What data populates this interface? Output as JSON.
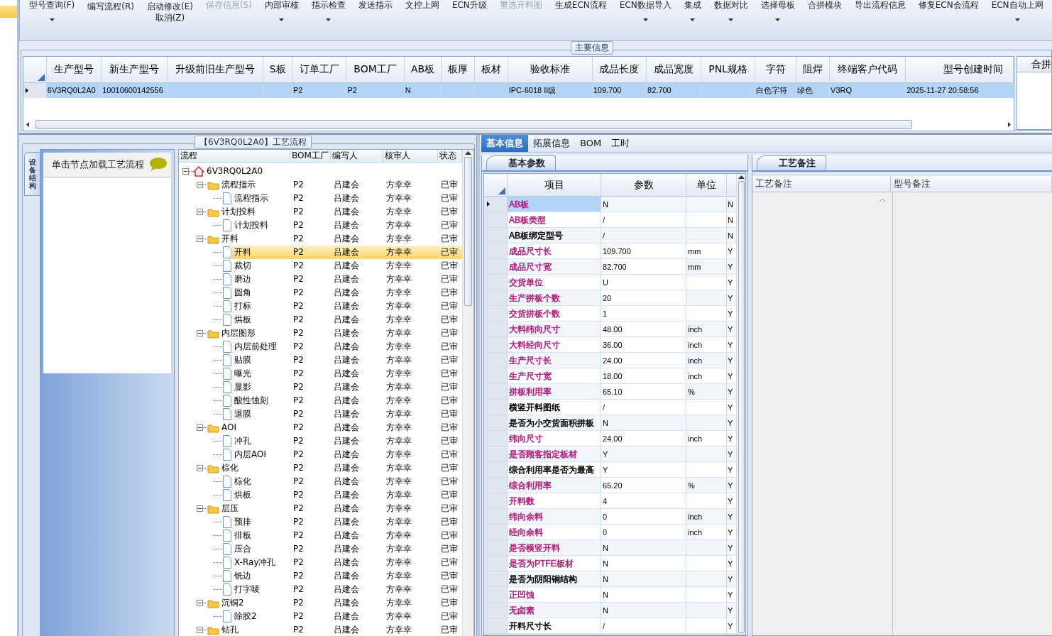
{
  "toolbar": {
    "columns": [
      {
        "buttons": [
          {
            "label": "型号查询(F)",
            "kind": "upper",
            "dropdown": true,
            "disabled": false
          }
        ]
      },
      {
        "buttons": [
          {
            "label": "编写流程(R)",
            "kind": "lower",
            "dropdown": false,
            "disabled": false
          }
        ]
      },
      {
        "buttons": [
          {
            "label": "启动修改(E)",
            "kind": "lower",
            "dropdown": false,
            "disabled": false
          },
          {
            "label": "取消(Z)",
            "kind": "lower",
            "dropdown": false,
            "disabled": false
          }
        ]
      },
      {
        "buttons": [
          {
            "label": "保存信息(S)",
            "kind": "upper",
            "dropdown": false,
            "disabled": true
          }
        ]
      },
      {
        "buttons": [
          {
            "label": "内部审核",
            "kind": "upper",
            "dropdown": true,
            "disabled": false
          }
        ]
      },
      {
        "buttons": [
          {
            "label": "指示检查",
            "kind": "upper",
            "dropdown": true,
            "disabled": false
          }
        ]
      },
      {
        "buttons": [
          {
            "label": "发送指示",
            "kind": "upper",
            "dropdown": false,
            "disabled": false
          }
        ]
      },
      {
        "buttons": [
          {
            "label": "文控上网",
            "kind": "upper",
            "dropdown": false,
            "disabled": false
          }
        ]
      },
      {
        "buttons": [
          {
            "label": "ECN升级",
            "kind": "upper",
            "dropdown": false,
            "disabled": false
          }
        ]
      },
      {
        "buttons": [
          {
            "label": "重选开料图",
            "kind": "upper",
            "dropdown": false,
            "disabled": true
          }
        ]
      },
      {
        "buttons": [
          {
            "label": "生成ECN流程",
            "kind": "upper",
            "dropdown": false,
            "disabled": false
          }
        ]
      },
      {
        "buttons": [
          {
            "label": "ECN数据导入",
            "kind": "upper",
            "dropdown": true,
            "disabled": false
          }
        ]
      },
      {
        "buttons": [
          {
            "label": "集成",
            "kind": "upper",
            "dropdown": true,
            "disabled": false
          }
        ]
      },
      {
        "buttons": [
          {
            "label": "数据对比",
            "kind": "upper",
            "dropdown": true,
            "disabled": false
          }
        ]
      },
      {
        "buttons": [
          {
            "label": "选择母板",
            "kind": "upper",
            "dropdown": true,
            "disabled": false
          }
        ]
      },
      {
        "buttons": [
          {
            "label": "合拼模块",
            "kind": "upper",
            "dropdown": false,
            "disabled": false
          }
        ]
      },
      {
        "buttons": [
          {
            "label": "导出流程信息",
            "kind": "upper",
            "dropdown": false,
            "disabled": false
          }
        ]
      },
      {
        "buttons": [
          {
            "label": "修复ECN会流程",
            "kind": "upper",
            "dropdown": false,
            "disabled": false
          }
        ]
      },
      {
        "buttons": [
          {
            "label": "ECN自动上网",
            "kind": "upper",
            "dropdown": true,
            "disabled": false
          }
        ]
      }
    ]
  },
  "main_info": {
    "title": "主要信息",
    "columns": [
      "生产型号",
      "新生产型号",
      "升级前旧生产型号",
      "S板",
      "订单工厂",
      "BOM工厂",
      "AB板",
      "板厚",
      "板材",
      "验收标准",
      "成品长度",
      "成品宽度",
      "PNL规格",
      "字符",
      "阻焊",
      "终端客户代码",
      "型号创建时间"
    ],
    "rows": [
      {
        "selected": true,
        "cells": [
          "6V3RQ0L2A0",
          "10010600142556",
          null,
          null,
          "P2",
          "P2",
          "N",
          null,
          null,
          "IPC-6018 II级",
          "109.700",
          "82.700",
          null,
          "白色字符",
          "绿色",
          "V3RQ",
          "2025-11-27 20:58:56"
        ]
      }
    ],
    "side_column": "合拼"
  },
  "flow": {
    "title": "【6V3RQ0L2A0】工艺流程",
    "side_tab": "设备结构",
    "hint": "单击节点加载工艺流程",
    "columns": [
      "流程",
      "BOM工厂",
      "编写人",
      "核审人",
      "状态"
    ],
    "tree": [
      {
        "label": "6V3RQ0L2A0",
        "kind": "root",
        "expanded": true,
        "selected": false,
        "children": [
          {
            "label": "流程指示",
            "kind": "folder",
            "expanded": true,
            "selected": false,
            "bom": "P2",
            "writer": "吕建会",
            "reviewer": "方幸幸",
            "status": "已审",
            "children": [
              {
                "label": "流程指示",
                "kind": "step",
                "selected": false,
                "bom": "P2",
                "writer": "吕建会",
                "reviewer": "方幸幸",
                "status": "已审"
              }
            ]
          },
          {
            "label": "计划投料",
            "kind": "folder",
            "expanded": true,
            "selected": false,
            "bom": "P2",
            "writer": "吕建会",
            "reviewer": "方幸幸",
            "status": "已审",
            "children": [
              {
                "label": "计划投料",
                "kind": "step",
                "selected": false,
                "bom": "P2",
                "writer": "吕建会",
                "reviewer": "方幸幸",
                "status": "已审"
              }
            ]
          },
          {
            "label": "开料",
            "kind": "folder",
            "expanded": true,
            "selected": false,
            "bom": "P2",
            "writer": "吕建会",
            "reviewer": "方幸幸",
            "status": "已审",
            "children": [
              {
                "label": "开料",
                "kind": "step",
                "selected": true,
                "bom": "P2",
                "writer": "吕建会",
                "reviewer": "方幸幸",
                "status": "已审"
              },
              {
                "label": "裁切",
                "kind": "step",
                "selected": false,
                "bom": "P2",
                "writer": "吕建会",
                "reviewer": "方幸幸",
                "status": "已审"
              },
              {
                "label": "磨边",
                "kind": "step",
                "selected": false,
                "bom": "P2",
                "writer": "吕建会",
                "reviewer": "方幸幸",
                "status": "已审"
              },
              {
                "label": "圆角",
                "kind": "step",
                "selected": false,
                "bom": "P2",
                "writer": "吕建会",
                "reviewer": "方幸幸",
                "status": "已审"
              },
              {
                "label": "打标",
                "kind": "step",
                "selected": false,
                "bom": "P2",
                "writer": "吕建会",
                "reviewer": "方幸幸",
                "status": "已审"
              },
              {
                "label": "烘板",
                "kind": "step",
                "selected": false,
                "bom": "P2",
                "writer": "吕建会",
                "reviewer": "方幸幸",
                "status": "已审"
              }
            ]
          },
          {
            "label": "内层图形",
            "kind": "folder",
            "expanded": true,
            "selected": false,
            "bom": "P2",
            "writer": "吕建会",
            "reviewer": "方幸幸",
            "status": "已审",
            "children": [
              {
                "label": "内层前处理",
                "kind": "step",
                "selected": false,
                "bom": "P2",
                "writer": "吕建会",
                "reviewer": "方幸幸",
                "status": "已审"
              },
              {
                "label": "贴膜",
                "kind": "step",
                "selected": false,
                "bom": "P2",
                "writer": "吕建会",
                "reviewer": "方幸幸",
                "status": "已审"
              },
              {
                "label": "曝光",
                "kind": "step",
                "selected": false,
                "bom": "P2",
                "writer": "吕建会",
                "reviewer": "方幸幸",
                "status": "已审"
              },
              {
                "label": "显影",
                "kind": "step",
                "selected": false,
                "bom": "P2",
                "writer": "吕建会",
                "reviewer": "方幸幸",
                "status": "已审"
              },
              {
                "label": "酸性蚀刻",
                "kind": "step",
                "selected": false,
                "bom": "P2",
                "writer": "吕建会",
                "reviewer": "方幸幸",
                "status": "已审"
              },
              {
                "label": "退膜",
                "kind": "step",
                "selected": false,
                "bom": "P2",
                "writer": "吕建会",
                "reviewer": "方幸幸",
                "status": "已审"
              }
            ]
          },
          {
            "label": "AOI",
            "kind": "folder",
            "expanded": true,
            "selected": false,
            "bom": "P2",
            "writer": "吕建会",
            "reviewer": "方幸幸",
            "status": "已审",
            "children": [
              {
                "label": "冲孔",
                "kind": "step",
                "selected": false,
                "bom": "P2",
                "writer": "吕建会",
                "reviewer": "方幸幸",
                "status": "已审"
              },
              {
                "label": "内层AOI",
                "kind": "step",
                "selected": false,
                "bom": "P2",
                "writer": "吕建会",
                "reviewer": "方幸幸",
                "status": "已审"
              }
            ]
          },
          {
            "label": "棕化",
            "kind": "folder",
            "expanded": true,
            "selected": false,
            "bom": "P2",
            "writer": "吕建会",
            "reviewer": "方幸幸",
            "status": "已审",
            "children": [
              {
                "label": "棕化",
                "kind": "step",
                "selected": false,
                "bom": "P2",
                "writer": "吕建会",
                "reviewer": "方幸幸",
                "status": "已审"
              },
              {
                "label": "烘板",
                "kind": "step",
                "selected": false,
                "bom": "P2",
                "writer": "吕建会",
                "reviewer": "方幸幸",
                "status": "已审"
              }
            ]
          },
          {
            "label": "层压",
            "kind": "folder",
            "expanded": true,
            "selected": false,
            "bom": "P2",
            "writer": "吕建会",
            "reviewer": "方幸幸",
            "status": "已审",
            "children": [
              {
                "label": "预排",
                "kind": "step",
                "selected": false,
                "bom": "P2",
                "writer": "吕建会",
                "reviewer": "方幸幸",
                "status": "已审"
              },
              {
                "label": "排板",
                "kind": "step",
                "selected": false,
                "bom": "P2",
                "writer": "吕建会",
                "reviewer": "方幸幸",
                "status": "已审"
              },
              {
                "label": "压合",
                "kind": "step",
                "selected": false,
                "bom": "P2",
                "writer": "吕建会",
                "reviewer": "方幸幸",
                "status": "已审"
              },
              {
                "label": "X-Ray冲孔",
                "kind": "step",
                "selected": false,
                "bom": "P2",
                "writer": "吕建会",
                "reviewer": "方幸幸",
                "status": "已审"
              },
              {
                "label": "铣边",
                "kind": "step",
                "selected": false,
                "bom": "P2",
                "writer": "吕建会",
                "reviewer": "方幸幸",
                "status": "已审"
              },
              {
                "label": "打字唛",
                "kind": "step",
                "selected": false,
                "bom": "P2",
                "writer": "吕建会",
                "reviewer": "方幸幸",
                "status": "已审"
              }
            ]
          },
          {
            "label": "沉铜2",
            "kind": "folder",
            "expanded": true,
            "selected": false,
            "bom": "P2",
            "writer": "吕建会",
            "reviewer": "方幸幸",
            "status": "已审",
            "children": [
              {
                "label": "除胶2",
                "kind": "step",
                "selected": false,
                "bom": "P2",
                "writer": "吕建会",
                "reviewer": "方幸幸",
                "status": "已审"
              }
            ]
          },
          {
            "label": "钻孔",
            "kind": "folder",
            "expanded": true,
            "selected": false,
            "bom": "P2",
            "writer": "吕建会",
            "reviewer": "方幸幸",
            "status": "已审"
          }
        ]
      }
    ]
  },
  "detail_tabs": [
    {
      "label": "基本信息",
      "selected": true
    },
    {
      "label": "拓展信息",
      "selected": false
    },
    {
      "label": "BOM",
      "selected": false
    },
    {
      "label": "工时",
      "selected": false
    }
  ],
  "params": {
    "tab": "基本参数",
    "columns": [
      "项目",
      "参数",
      "单位"
    ],
    "rows": [
      {
        "item": "AB板",
        "value": "N",
        "flag": "N",
        "color": "#b0187a",
        "selected": true
      },
      {
        "item": "AB板类型",
        "value": "/",
        "flag": "N",
        "color": "#b0187a",
        "selected": false
      },
      {
        "item": "AB板绑定型号",
        "value": "/",
        "flag": "N",
        "color": "#000000",
        "selected": false
      },
      {
        "item": "成品尺寸长",
        "value": "109.700",
        "unit": "mm",
        "flag": "Y",
        "color": "#b0187a",
        "selected": false
      },
      {
        "item": "成品尺寸宽",
        "value": "82.700",
        "unit": "mm",
        "flag": "Y",
        "color": "#b0187a",
        "selected": false
      },
      {
        "item": "交货单位",
        "value": "U",
        "flag": "Y",
        "color": "#b0187a",
        "selected": false
      },
      {
        "item": "生产拼板个数",
        "value": "20",
        "flag": "Y",
        "color": "#b0187a",
        "selected": false
      },
      {
        "item": "交货拼板个数",
        "value": "1",
        "flag": "Y",
        "color": "#b0187a",
        "selected": false
      },
      {
        "item": "大料纬向尺寸",
        "value": "48.00",
        "unit": "inch",
        "flag": "Y",
        "color": "#b0187a",
        "selected": false
      },
      {
        "item": "大料经向尺寸",
        "value": "36.00",
        "unit": "inch",
        "flag": "Y",
        "color": "#b0187a",
        "selected": false
      },
      {
        "item": "生产尺寸长",
        "value": "24.00",
        "unit": "inch",
        "flag": "Y",
        "color": "#b0187a",
        "selected": false
      },
      {
        "item": "生产尺寸宽",
        "value": "18.00",
        "unit": "inch",
        "flag": "Y",
        "color": "#b0187a",
        "selected": false
      },
      {
        "item": "拼板利用率",
        "value": "65.10",
        "unit": "%",
        "flag": "Y",
        "color": "#b0187a",
        "selected": false
      },
      {
        "item": "横竖开料图纸",
        "value": "/",
        "flag": "Y",
        "color": "#000000",
        "selected": false
      },
      {
        "item": "是否为小交货面积拼板",
        "value": "N",
        "flag": "Y",
        "color": "#000000",
        "selected": false
      },
      {
        "item": "纬向尺寸",
        "value": "24.00",
        "unit": "inch",
        "flag": "Y",
        "color": "#b0187a",
        "selected": false
      },
      {
        "item": "是否顾客指定板材",
        "value": "Y",
        "flag": "Y",
        "color": "#b0187a",
        "selected": false
      },
      {
        "item": "综合利用率是否为最高",
        "value": "Y",
        "flag": "Y",
        "color": "#000000",
        "selected": false
      },
      {
        "item": "综合利用率",
        "value": "65.20",
        "unit": "%",
        "flag": "Y",
        "color": "#b0187a",
        "selected": false
      },
      {
        "item": "开料数",
        "value": "4",
        "flag": "Y",
        "color": "#b0187a",
        "selected": false
      },
      {
        "item": "纬向余料",
        "value": "0",
        "unit": "inch",
        "flag": "Y",
        "color": "#b0187a",
        "selected": false
      },
      {
        "item": "经向余料",
        "value": "0",
        "unit": "inch",
        "flag": "Y",
        "color": "#b0187a",
        "selected": false
      },
      {
        "item": "是否横竖开料",
        "value": "N",
        "flag": "Y",
        "color": "#b0187a",
        "selected": false
      },
      {
        "item": "是否为PTFE板材",
        "value": "N",
        "flag": "Y",
        "color": "#b0187a",
        "selected": false
      },
      {
        "item": "是否为阴阳铜结构",
        "value": "N",
        "flag": "Y",
        "color": "#000000",
        "selected": false
      },
      {
        "item": "正凹蚀",
        "value": "N",
        "flag": "Y",
        "color": "#b0187a",
        "selected": false
      },
      {
        "item": "无卤素",
        "value": "N",
        "flag": "Y",
        "color": "#b0187a",
        "selected": false
      },
      {
        "item": "开料尺寸长",
        "value": "/",
        "flag": "Y",
        "color": "#000000",
        "selected": false
      }
    ]
  },
  "notes": {
    "tab": "工艺备注",
    "columns": [
      "工艺备注",
      "型号备注"
    ]
  }
}
